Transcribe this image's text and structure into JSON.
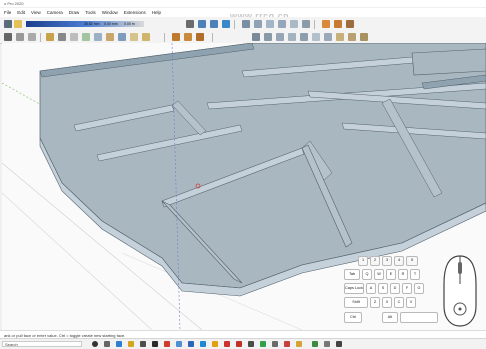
{
  "window": {
    "title": "o Pro 2020"
  },
  "menu": [
    "File",
    "Edit",
    "View",
    "Camera",
    "Draw",
    "Tools",
    "Window",
    "Extensions",
    "Help"
  ],
  "watermark": "www.rrcg.cn",
  "toolbar": {
    "measure_values": [
      "35.82 mm",
      "0.00 mm",
      "0.00 m"
    ]
  },
  "status": {
    "hint": "ank or pull face or enter value.  Ctrl = toggle create new starting face."
  },
  "taskbar": {
    "search_placeholder": "Search"
  },
  "keyboard": {
    "number_keys": [
      "1",
      "2",
      "3",
      "4",
      "5"
    ],
    "row1": [
      "Q",
      "W",
      "E",
      "R",
      "T"
    ],
    "row2": [
      "A",
      "S",
      "D",
      "F",
      "G"
    ],
    "row3": [
      "Z",
      "X",
      "C",
      "V"
    ],
    "left_keys": [
      "Tab",
      "Caps Lock",
      "Shift",
      "Ctrl",
      "Alt"
    ]
  },
  "colors": {
    "floor": "#a9b7c1",
    "wall_top": "#8ea2b0",
    "wall_side": "#c5d1da",
    "ground": "#f7f7f7"
  }
}
